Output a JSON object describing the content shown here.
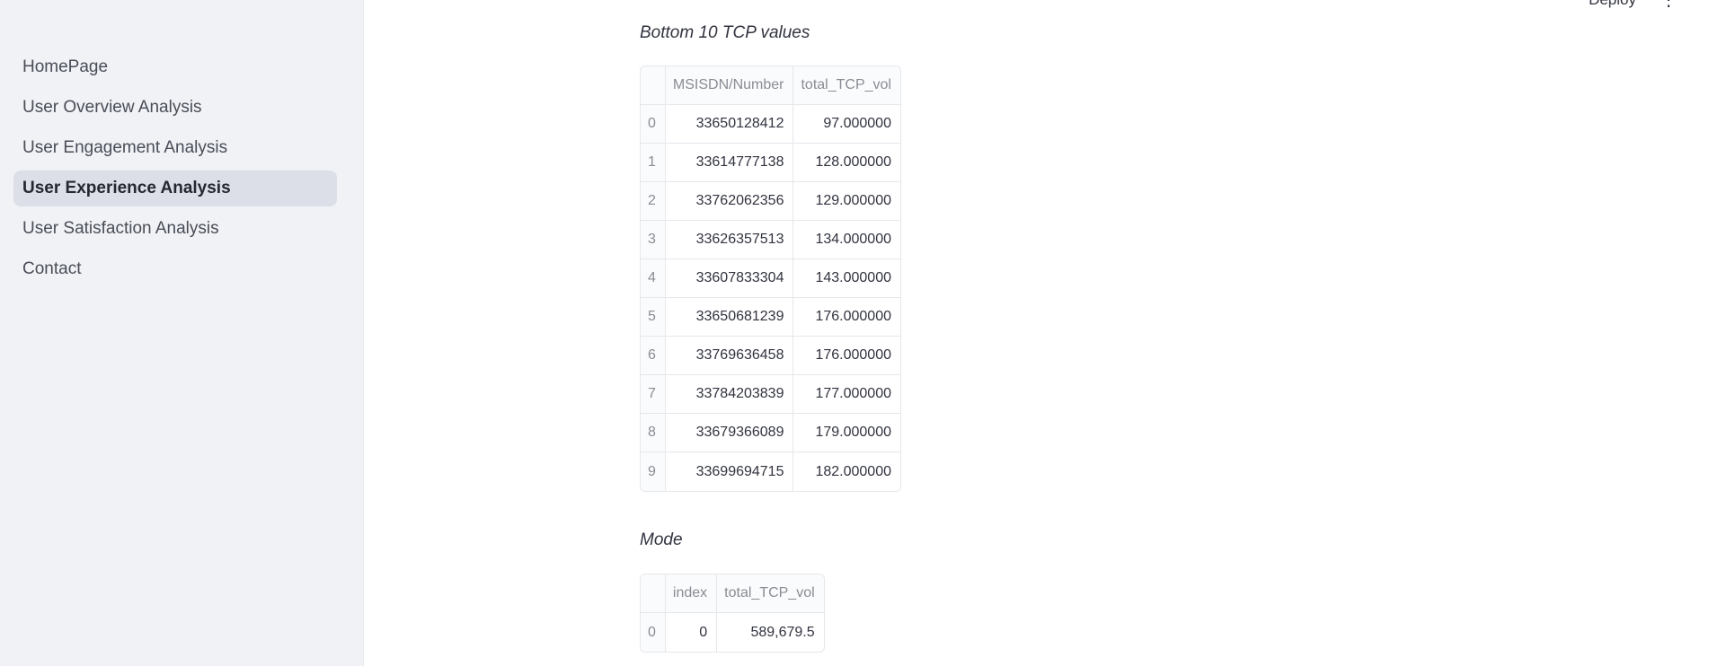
{
  "sidebar": {
    "items": [
      {
        "label": "HomePage",
        "active": false
      },
      {
        "label": "User Overview Analysis",
        "active": false
      },
      {
        "label": "User Engagement Analysis",
        "active": false
      },
      {
        "label": "User Experience Analysis",
        "active": true
      },
      {
        "label": "User Satisfaction Analysis",
        "active": false
      },
      {
        "label": "Contact",
        "active": false
      }
    ]
  },
  "header": {
    "deploy_label": "Deploy",
    "menu_icon": "vertical-dots-icon"
  },
  "bottom_table": {
    "caption": "Bottom 10 TCP values",
    "columns": [
      "",
      "MSISDN/Number",
      "total_TCP_vol"
    ],
    "rows": [
      [
        "0",
        "33650128412",
        "97.000000"
      ],
      [
        "1",
        "33614777138",
        "128.000000"
      ],
      [
        "2",
        "33762062356",
        "129.000000"
      ],
      [
        "3",
        "33626357513",
        "134.000000"
      ],
      [
        "4",
        "33607833304",
        "143.000000"
      ],
      [
        "5",
        "33650681239",
        "176.000000"
      ],
      [
        "6",
        "33769636458",
        "176.000000"
      ],
      [
        "7",
        "33784203839",
        "177.000000"
      ],
      [
        "8",
        "33679366089",
        "179.000000"
      ],
      [
        "9",
        "33699694715",
        "182.000000"
      ]
    ]
  },
  "mode_table": {
    "caption": "Mode",
    "columns": [
      "",
      "index",
      "total_TCP_vol"
    ],
    "rows": [
      [
        "0",
        "0",
        "589,679.5"
      ]
    ]
  },
  "colors": {
    "sidebar_bg": "#f0f2f6",
    "active_item_bg": "#dcdfe8",
    "text": "#31333f",
    "muted": "#8a8c94"
  }
}
